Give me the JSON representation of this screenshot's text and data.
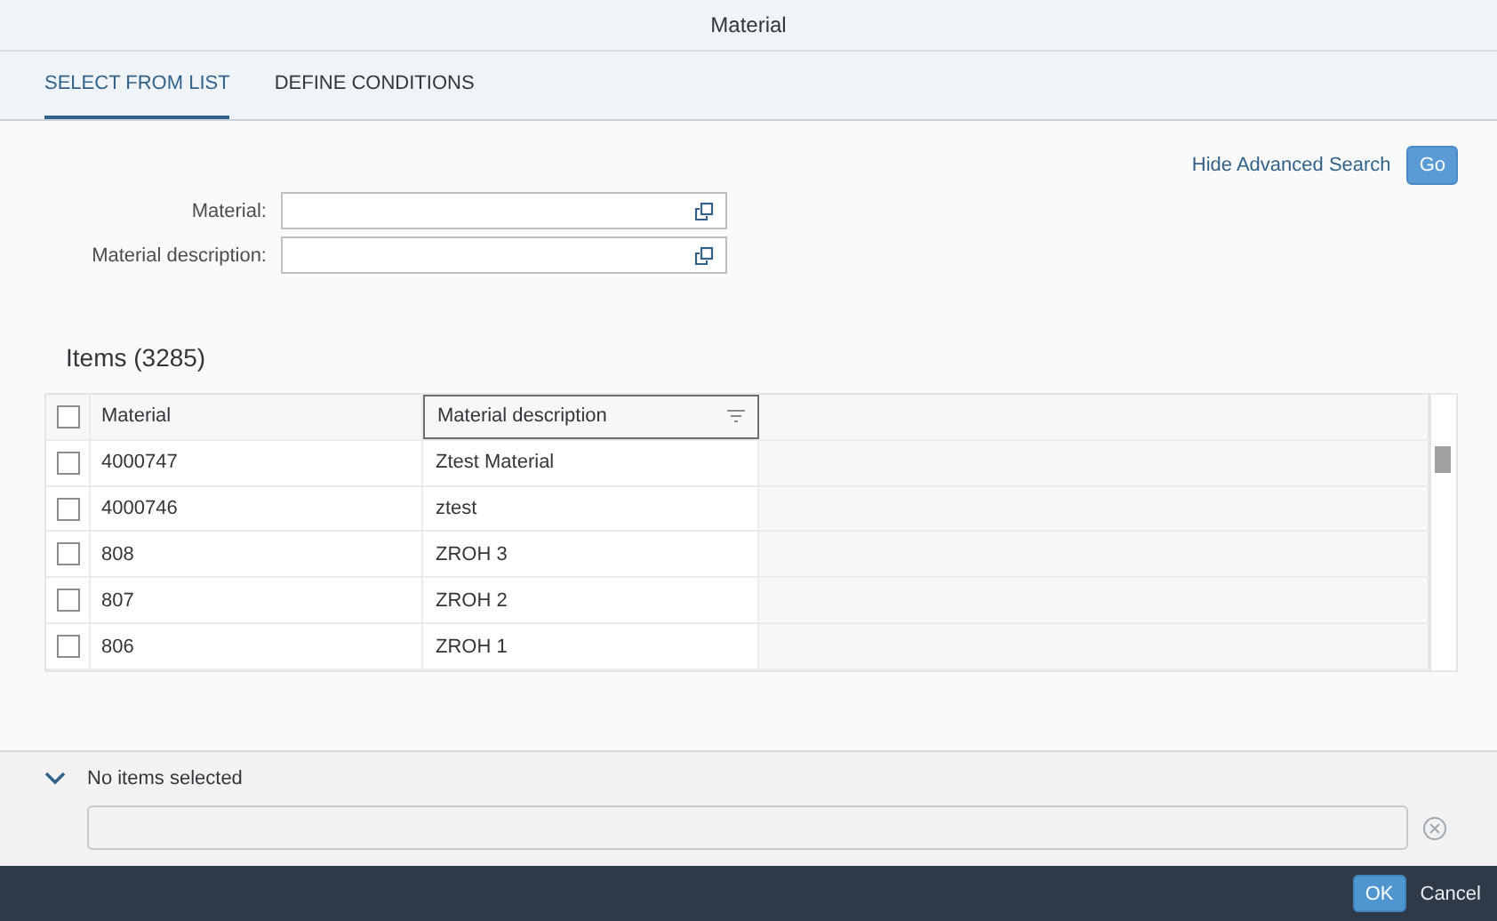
{
  "window": {
    "title": "Material"
  },
  "tabs": [
    {
      "label": "SELECT FROM LIST",
      "selected": true
    },
    {
      "label": "DEFINE CONDITIONS",
      "selected": false
    }
  ],
  "toolbar": {
    "link": "Hide Advanced Search",
    "button": "Go"
  },
  "filters": [
    {
      "label": "Material:"
    },
    {
      "label": "Material description:"
    }
  ],
  "table": {
    "title": "Items (3285)",
    "all_checked": false,
    "columns": [
      {
        "label": "Material",
        "focused": false
      },
      {
        "label": "Material description",
        "focused": true
      }
    ],
    "rows": [
      {
        "checked": false,
        "cells": [
          "4000747",
          "Ztest Material"
        ]
      },
      {
        "checked": false,
        "cells": [
          "4000746",
          "ztest"
        ]
      },
      {
        "checked": false,
        "cells": [
          "808",
          "ZROH 3"
        ]
      },
      {
        "checked": false,
        "cells": [
          "807",
          "ZROH 2"
        ]
      },
      {
        "checked": false,
        "cells": [
          "806",
          "ZROH 1"
        ]
      }
    ]
  },
  "selection": {
    "label": "No items selected",
    "expanded": true
  },
  "footer": {
    "buttons": [
      {
        "label": "OK",
        "kind": "primary"
      },
      {
        "label": "Cancel",
        "kind": "plain"
      }
    ]
  }
}
